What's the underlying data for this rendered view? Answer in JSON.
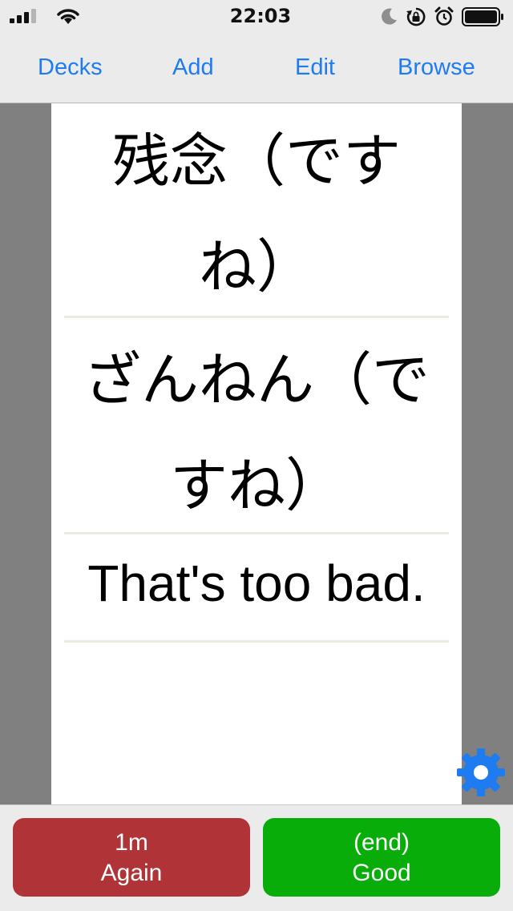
{
  "status_bar": {
    "time": "22:03",
    "icons": [
      "cellular-signal-icon",
      "wifi-icon",
      "moon-icon",
      "rotation-lock-icon",
      "alarm-icon",
      "battery-icon"
    ]
  },
  "nav": {
    "decks": "Decks",
    "add": "Add",
    "edit": "Edit",
    "browse": "Browse"
  },
  "card": {
    "expression_line1": "残念（です",
    "expression_line2": "ね）",
    "reading_line1": "ざんねん（で",
    "reading_line2": "すね）",
    "meaning": "That's too bad."
  },
  "answers": {
    "again": {
      "interval": "1m",
      "label": "Again"
    },
    "good": {
      "interval": "(end)",
      "label": "Good"
    }
  },
  "colors": {
    "accent": "#1f7cf0",
    "again_button": "#b03437",
    "good_button": "#08ad0a",
    "side_panel": "#808080",
    "divider": "#ece9e1"
  }
}
